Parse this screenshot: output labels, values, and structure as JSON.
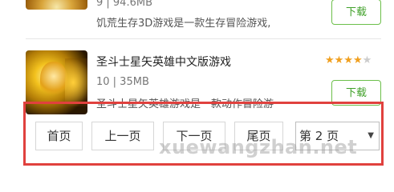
{
  "items": [
    {
      "meta": "9 | 94.6MB",
      "description": "饥荒生存3D游戏是一款生存冒险游戏,",
      "download_label": "下载"
    },
    {
      "title": "圣斗士星矢英雄中文版游戏",
      "rating": 4,
      "rating_max": 5,
      "meta": "10 | 35MB",
      "description": "圣斗士星矢英雄游戏是一款动作冒险游",
      "download_label": "下载"
    }
  ],
  "pagination": {
    "first": "首页",
    "prev": "上一页",
    "next": "下一页",
    "last": "尾页",
    "current_page": "第 2 页"
  },
  "watermark": "xuewangzhan.net",
  "colors": {
    "accent_green": "#3fa028",
    "star": "#f0a020",
    "highlight_box": "#e0413e"
  }
}
